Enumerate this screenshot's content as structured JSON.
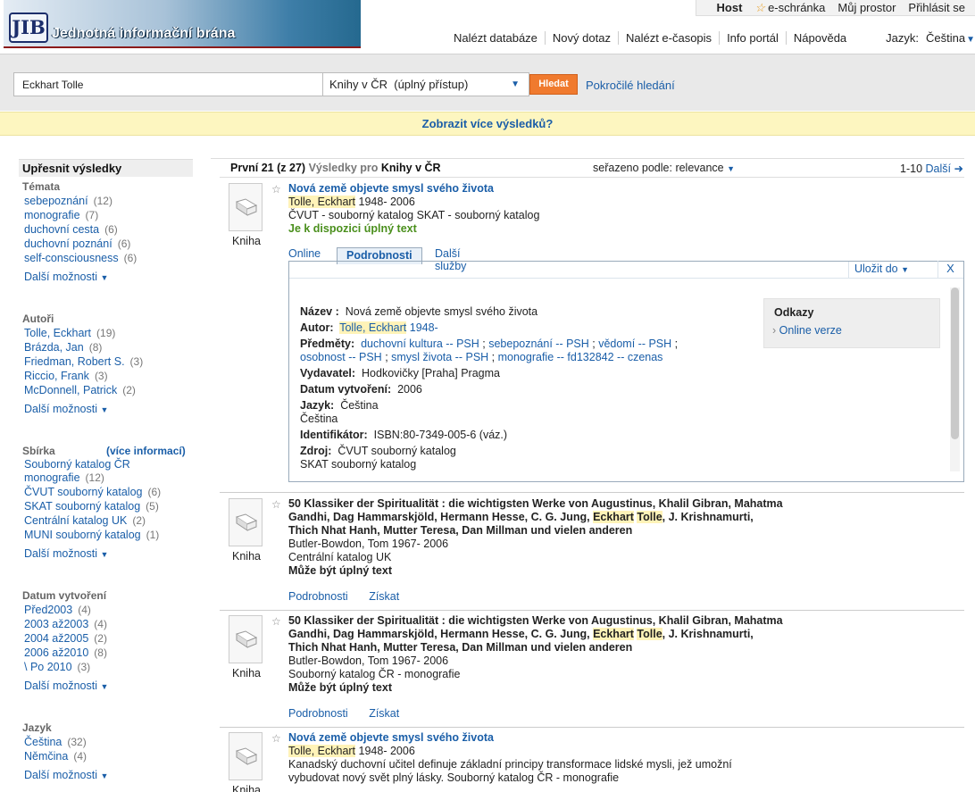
{
  "header": {
    "logo_mark": "JIB",
    "logo_text": "Jednotná informační brána",
    "top_nav": {
      "host": "Host",
      "eschranka": "e-schránka",
      "my_space": "Můj prostor",
      "login": "Přihlásit se"
    },
    "main_nav": [
      "Nalézt databáze",
      "Nový dotaz",
      "Nalézt e-časopis",
      "Info portál",
      "Nápověda"
    ],
    "language_label": "Jazyk:",
    "language_value": "Čeština"
  },
  "search": {
    "query": "Eckhart Tolle",
    "scope": "Knihy v ČR  (úplný přístup)",
    "go_label": "Hledat",
    "advanced_label": "Pokročilé hledání"
  },
  "more_results": "Zobrazit více výsledků?",
  "facets": {
    "title": "Upřesnit výsledky",
    "more_label": "Další možnosti",
    "groups": [
      {
        "name": "Témata",
        "items": [
          {
            "label": "sebepoznání",
            "count": "(12)"
          },
          {
            "label": "monografie",
            "count": "(7)"
          },
          {
            "label": "duchovní cesta",
            "count": "(6)"
          },
          {
            "label": "duchovní poznání",
            "count": "(6)"
          },
          {
            "label": "self-consciousness",
            "count": "(6)"
          }
        ]
      },
      {
        "name": "Autoři",
        "items": [
          {
            "label": "Tolle, Eckhart",
            "count": "(19)"
          },
          {
            "label": "Brázda, Jan",
            "count": "(8)"
          },
          {
            "label": "Friedman, Robert S.",
            "count": "(3)"
          },
          {
            "label": "Riccio, Frank",
            "count": "(3)"
          },
          {
            "label": "McDonnell, Patrick",
            "count": "(2)"
          }
        ]
      },
      {
        "name": "Sbírka",
        "extra": "(více informací)",
        "items": [
          {
            "label": "Souborný katalog ČR monografie",
            "count": "(12)"
          },
          {
            "label": "ČVUT souborný katalog",
            "count": "(6)"
          },
          {
            "label": "SKAT souborný katalog",
            "count": "(5)"
          },
          {
            "label": "Centrální katalog UK",
            "count": "(2)"
          },
          {
            "label": "MUNI souborný katalog",
            "count": "(1)"
          }
        ]
      },
      {
        "name": "Datum vytvoření",
        "items": [
          {
            "label": "Před2003",
            "count": "(4)"
          },
          {
            "label": "2003 až2003",
            "count": "(4)"
          },
          {
            "label": "2004 až2005",
            "count": "(2)"
          },
          {
            "label": "2006 až2010",
            "count": "(8)"
          },
          {
            "label": "\\ Po 2010",
            "count": "(3)"
          }
        ]
      },
      {
        "name": "Jazyk",
        "items": [
          {
            "label": "Čeština",
            "count": "(32)"
          },
          {
            "label": "Němčina",
            "count": "(4)"
          }
        ]
      }
    ]
  },
  "results": {
    "first": "První 21",
    "of": "(z 27)",
    "label": "Výsledky pro",
    "target": "Knihy v ČR",
    "sort_label": "seřazeno podle:",
    "sort_value": "relevance",
    "range": "1-10",
    "next": "Další",
    "kind": "Kniha",
    "records": [
      {
        "title": "Nová země objevte smysl svého života",
        "author_a": "Tolle, ",
        "author_b": "Eckhart",
        "author_c": " 1948- 2006",
        "source": "ČVUT - souborný katalog SKAT - souborný katalog",
        "availability": "Je k dispozici úplný text"
      },
      {
        "t1": "50 Klassiker der Spiritualität : die wichtigsten Werke von Augustinus, Khalil Gibran, Mahatma",
        "t2a": "Gandhi, Dag Hammarskjöld, Hermann Hesse, C. G. Jung, ",
        "t2b": "Eckhart",
        "t2c": " ",
        "t2d": "Tolle",
        "t2e": ", J. Krishnamurti,",
        "t3": "Thich Nhat Hanh, Mutter Teresa, Dan Millman und vielen anderen",
        "author": "Butler-Bowdon, Tom 1967- 2006",
        "source": "Centrální katalog UK",
        "availability": "Může být úplný text",
        "links": [
          "Podrobnosti",
          "Získat"
        ]
      },
      {
        "t1": "50 Klassiker der Spiritualität : die wichtigsten Werke von Augustinus, Khalil Gibran, Mahatma",
        "t2a": "Gandhi, Dag Hammarskjöld, Hermann Hesse, C. G. Jung, ",
        "t2b": "Eckhart",
        "t2c": " ",
        "t2d": "Tolle",
        "t2e": ", J. Krishnamurti,",
        "t3": "Thich Nhat Hanh, Mutter Teresa, Dan Millman und vielen anderen",
        "author": "Butler-Bowdon, Tom 1967- 2006",
        "source": "Souborný katalog ČR - monografie",
        "availability": "Může být úplný text",
        "links": [
          "Podrobnosti",
          "Získat"
        ]
      },
      {
        "title": "Nová země objevte smysl svého života",
        "author_a": "Tolle, ",
        "author_b": "Eckhart",
        "author_c": " 1948- 2006",
        "desc1": "Kanadský duchovní učitel definuje základní principy transformace lidské mysli, jež umožní",
        "desc2": "vybudovat nový svět plný lásky. Souborný katalog ČR - monografie"
      }
    ]
  },
  "detail": {
    "tabs": [
      "Online",
      "Podrobnosti",
      "Další služby"
    ],
    "save_label": "Uložit do",
    "close": "X",
    "fields": {
      "name_label": "Název :",
      "name": "Nová země objevte smysl svého života",
      "author_label": "Autor:",
      "author_a": "Tolle, ",
      "author_b": "Eckhart",
      "author_c": " 1948-",
      "subjects_label": "Předměty:",
      "subjects": [
        "duchovní kultura -- PSH",
        "sebepoznání -- PSH",
        "vědomí -- PSH",
        "osobnost -- PSH",
        "smysl života -- PSH",
        "monografie -- fd132842 -- czenas"
      ],
      "publisher_label": "Vydavatel:",
      "publisher": "Hodkovičky [Praha] Pragma",
      "date_label": "Datum vytvoření:",
      "date": "2006",
      "lang_label": "Jazyk:",
      "lang1": "Čeština",
      "lang2": "Čeština",
      "id_label": "Identifikátor:",
      "id": "ISBN:80-7349-005-6 (váz.)",
      "src_label": "Zdroj:",
      "src1": "ČVUT souborný katalog",
      "src2": "SKAT souborný katalog"
    },
    "links_title": "Odkazy",
    "links_item": "Online verze"
  }
}
